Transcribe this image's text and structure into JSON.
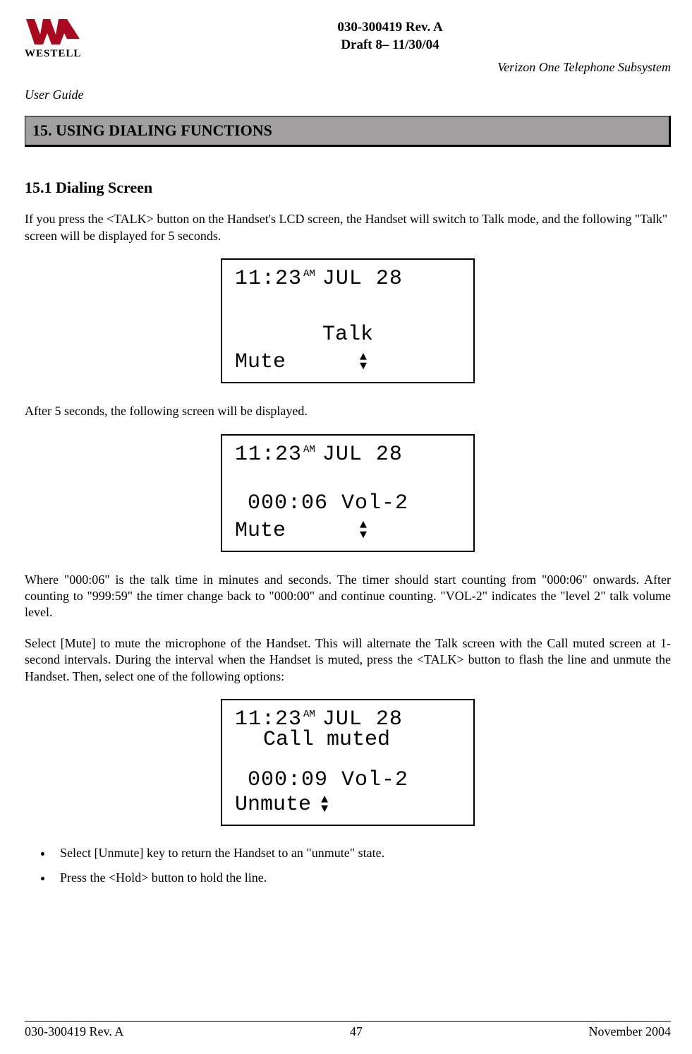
{
  "header": {
    "brand": "WESTELL",
    "docRev": "030-300419 Rev. A",
    "draft": "Draft 8– 11/30/04",
    "leftSub": "User Guide",
    "rightSub": "Verizon One Telephone Subsystem"
  },
  "section": {
    "banner": "15. USING DIALING FUNCTIONS",
    "h": "15.1 Dialing Screen",
    "p1": "If you press the <TALK> button on the Handset's LCD screen, the Handset will switch to Talk mode, and the following \"Talk\" screen will be displayed for 5 seconds.",
    "p2": "After 5 seconds, the following screen will be displayed.",
    "p3": "Where \"000:06\" is the talk time in minutes and seconds.  The timer should start counting from \"000:06\" onwards. After counting to \"999:59\" the timer change back to \"000:00\" and continue counting. \"VOL-2\" indicates the  \"level 2\" talk volume level.",
    "p4": "Select [Mute] to mute the microphone of the Handset. This will alternate the Talk screen with the Call muted screen at 1-second intervals.  During the interval when the Handset is muted, press the <TALK> button to flash the line and unmute the Handset. Then, select one of the following options:",
    "bullet1": "Select [Unmute] key to return the Handset to an \"unmute\" state.",
    "bullet2": "Press the <Hold> button to hold the line."
  },
  "lcd1": {
    "clock": "11:23",
    "ampm": "AM",
    "date": "JUL 28",
    "center": "Talk",
    "softkey": "Mute"
  },
  "lcd2": {
    "clock": "11:23",
    "ampm": "AM",
    "date": "JUL 28",
    "timer": "000:06 Vol-2",
    "softkey": "Mute"
  },
  "lcd3": {
    "clock": "11:23",
    "ampm": "AM",
    "date": "JUL 28",
    "status": "Call muted",
    "timer": "000:09 Vol-2",
    "softkey": "Unmute"
  },
  "footer": {
    "left": "030-300419 Rev. A",
    "center": "47",
    "right": "November 2004"
  }
}
